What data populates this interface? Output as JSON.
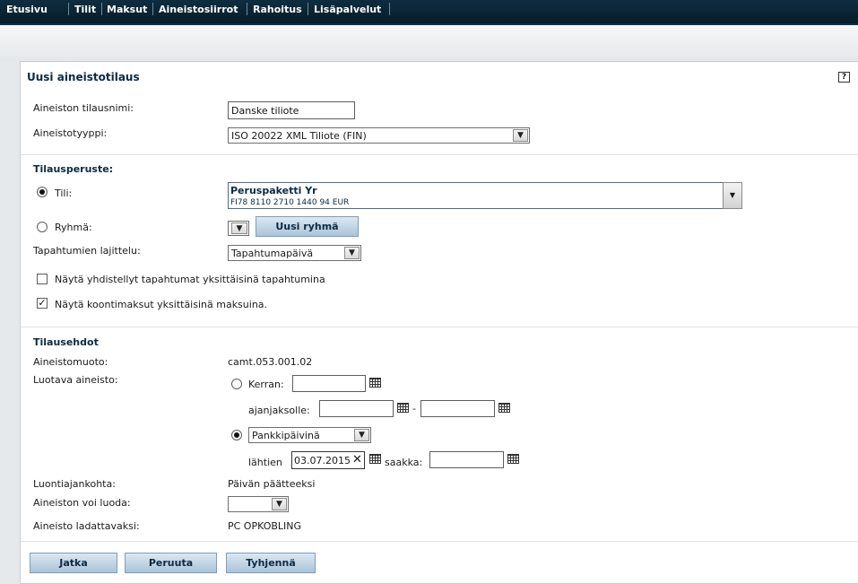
{
  "nav": {
    "items": [
      "Etusivu",
      "Tilit",
      "Maksut",
      "Aineistosiirrot",
      "Rahoitus",
      "Lisäpalvelut"
    ]
  },
  "form": {
    "title": "Uusi aineistotilaus",
    "name_label": "Aineiston tilausnimi:",
    "name_value": "Danske tiliote",
    "type_label": "Aineistotyyppi:",
    "type_value": "ISO 20022 XML Tiliote (FIN)"
  },
  "basis": {
    "title": "Tilausperuste:",
    "account_label": "Tili:",
    "account_name": "Peruspaketti Yr",
    "account_number": "FI78 8110 2710 1440 94 EUR",
    "group_label": "Ryhmä:",
    "new_group_button": "Uusi ryhmä",
    "sort_label": "Tapahtumien lajittelu:",
    "sort_value": "Tapahtumapäivä",
    "check1_label": "Näytä yhdistellyt tapahtumat yksittäisinä tapahtumina",
    "check1_checked": false,
    "check2_label": "Näytä koontimaksut yksittäisinä maksuina.",
    "check2_checked": true
  },
  "conditions": {
    "title": "Tilausehdot",
    "format_label": "Aineistomuoto:",
    "format_value": "camt.053.001.02",
    "created_label": "Luotava aineisto:",
    "once_label": "Kerran:",
    "period_label": "ajanjaksolle:",
    "period_dash": "-",
    "daily_value": "Pankkipäivinä",
    "from_label": "lähtien",
    "from_value": "03.07.2015",
    "until_label": "saakka:",
    "timing_label": "Luontiajankohta:",
    "timing_value": "Päivän päätteeksi",
    "can_create_label": "Aineiston voi luoda:",
    "download_label": "Aineisto ladattavaksi:",
    "download_value": "PC OPKOBLING"
  },
  "buttons": {
    "continue": "Jatka",
    "cancel": "Peruuta",
    "clear": "Tyhjennä"
  }
}
